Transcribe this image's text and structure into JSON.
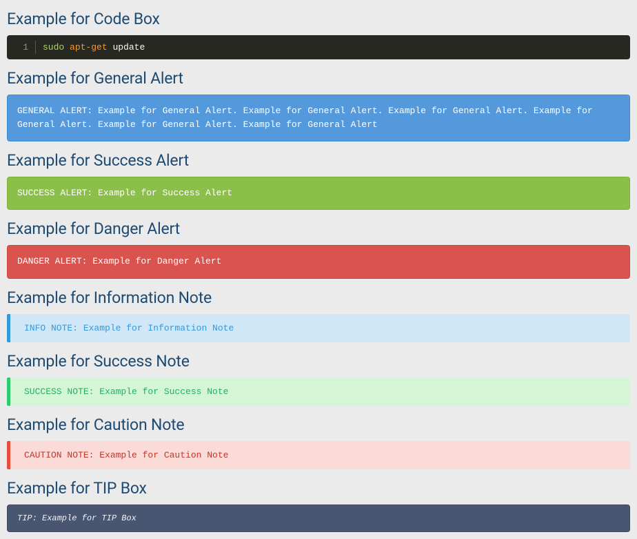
{
  "sections": {
    "codebox": {
      "heading": "Example for Code Box",
      "line_number": "1",
      "cmd_part1": "sudo",
      "cmd_part2": "apt-get",
      "cmd_part3": "update"
    },
    "general_alert": {
      "heading": "Example for General Alert",
      "text": "GENERAL ALERT: Example for General Alert. Example for General Alert. Example for General Alert. Example for General Alert. Example for General Alert. Example for General Alert"
    },
    "success_alert": {
      "heading": "Example for Success Alert",
      "text": "SUCCESS ALERT: Example for Success Alert"
    },
    "danger_alert": {
      "heading": "Example for Danger Alert",
      "text": "DANGER ALERT: Example for Danger Alert"
    },
    "info_note": {
      "heading": "Example for Information Note",
      "text": "INFO NOTE: Example for Information Note"
    },
    "success_note": {
      "heading": "Example for Success Note",
      "text": "SUCCESS NOTE: Example for Success Note"
    },
    "caution_note": {
      "heading": "Example for Caution Note",
      "text": "CAUTION NOTE: Example for Caution Note"
    },
    "tip_box": {
      "heading": "Example for TIP Box",
      "text": "TIP: Example for TIP Box"
    }
  }
}
